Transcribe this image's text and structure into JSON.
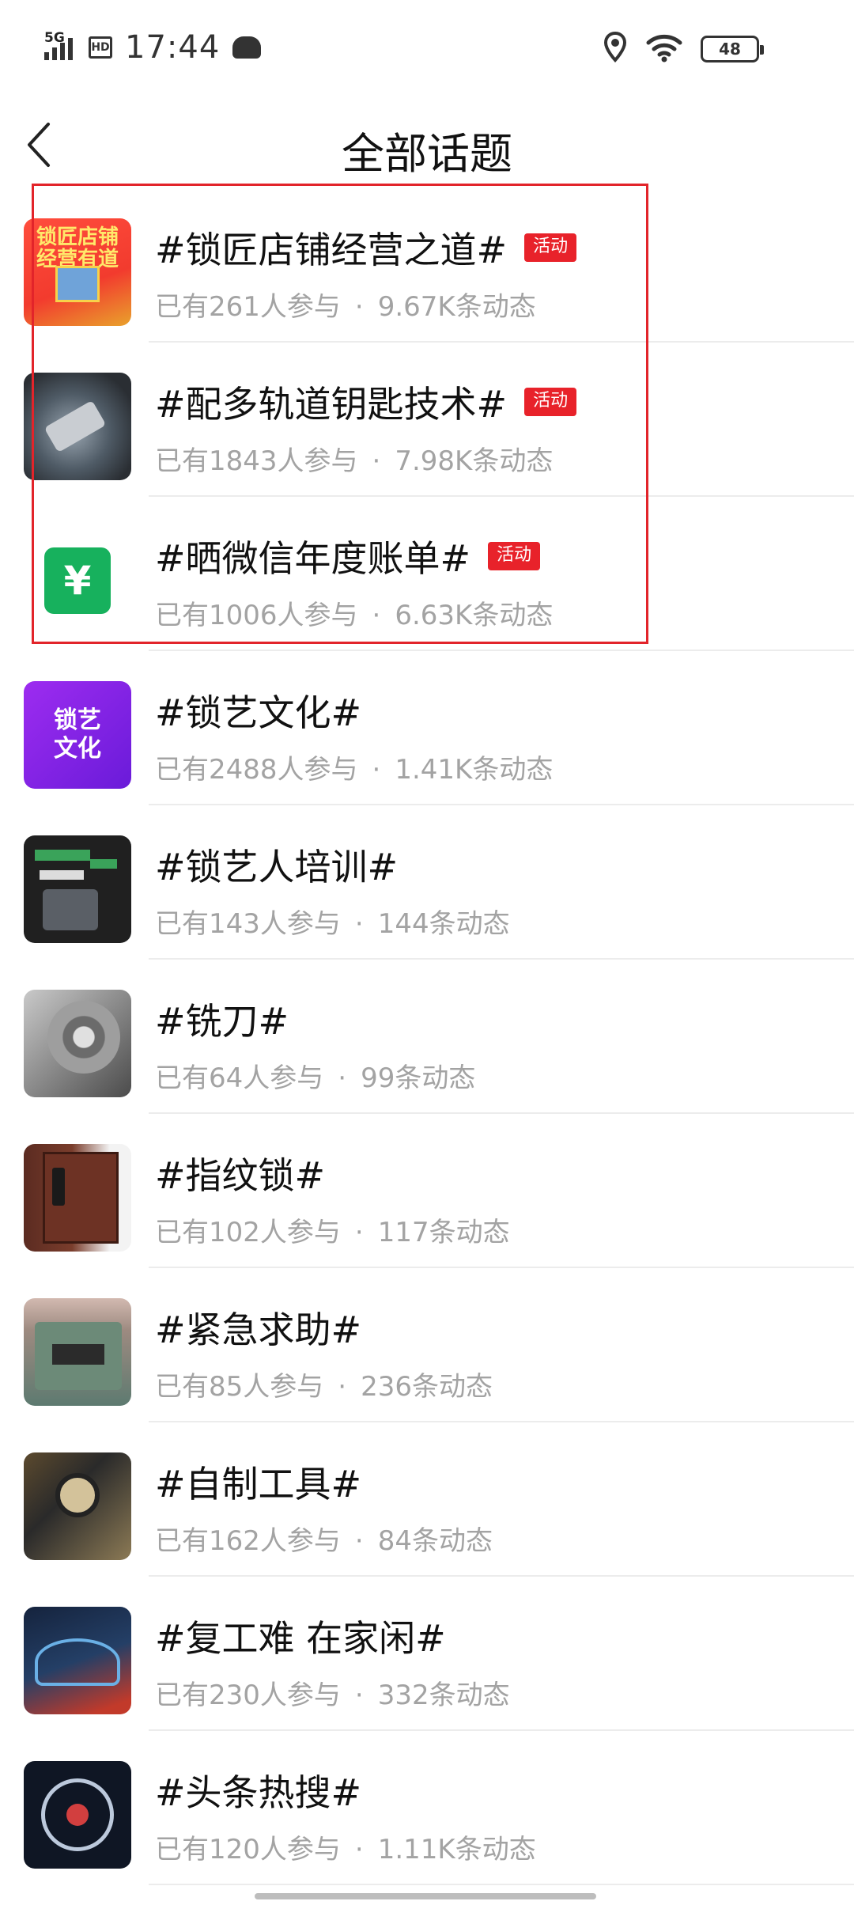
{
  "status_bar": {
    "signal": "5G",
    "hd": "HD",
    "time": "17:44",
    "battery": "48"
  },
  "header": {
    "title": "全部话题"
  },
  "tag_label": "活动",
  "topics": [
    {
      "title": "#锁匠店铺经营之道#",
      "tag": "活动",
      "participants": "已有261人参与",
      "posts": "9.67K条动态",
      "thumb_text": "锁匠店铺经营有道"
    },
    {
      "title": "#配多轨道钥匙技术#",
      "tag": "活动",
      "participants": "已有1843人参与",
      "posts": "7.98K条动态"
    },
    {
      "title": "#晒微信年度账单#",
      "tag": "活动",
      "participants": "已有1006人参与",
      "posts": "6.63K条动态",
      "thumb_text": "¥"
    },
    {
      "title": "#锁艺文化#",
      "participants": "已有2488人参与",
      "posts": "1.41K条动态",
      "thumb_text": "锁艺\n文化"
    },
    {
      "title": "#锁艺人培训#",
      "participants": "已有143人参与",
      "posts": "144条动态"
    },
    {
      "title": "#铣刀#",
      "participants": "已有64人参与",
      "posts": "99条动态"
    },
    {
      "title": "#指纹锁#",
      "participants": "已有102人参与",
      "posts": "117条动态"
    },
    {
      "title": "#紧急求助#",
      "participants": "已有85人参与",
      "posts": "236条动态"
    },
    {
      "title": "#自制工具#",
      "participants": "已有162人参与",
      "posts": "84条动态"
    },
    {
      "title": "#复工难 在家闲#",
      "participants": "已有230人参与",
      "posts": "332条动态"
    },
    {
      "title": "#头条热搜#",
      "participants": "已有120人参与",
      "posts": "1.11K条动态"
    }
  ],
  "colors": {
    "tag_red": "#e8222a",
    "highlight_box": "#e2242a",
    "meta_gray": "#a3a3a3",
    "separator": "#ececec"
  },
  "icons": {
    "back": "chevron-left-icon",
    "location": "location-pin-icon",
    "wifi": "wifi-icon",
    "battery": "battery-icon"
  }
}
